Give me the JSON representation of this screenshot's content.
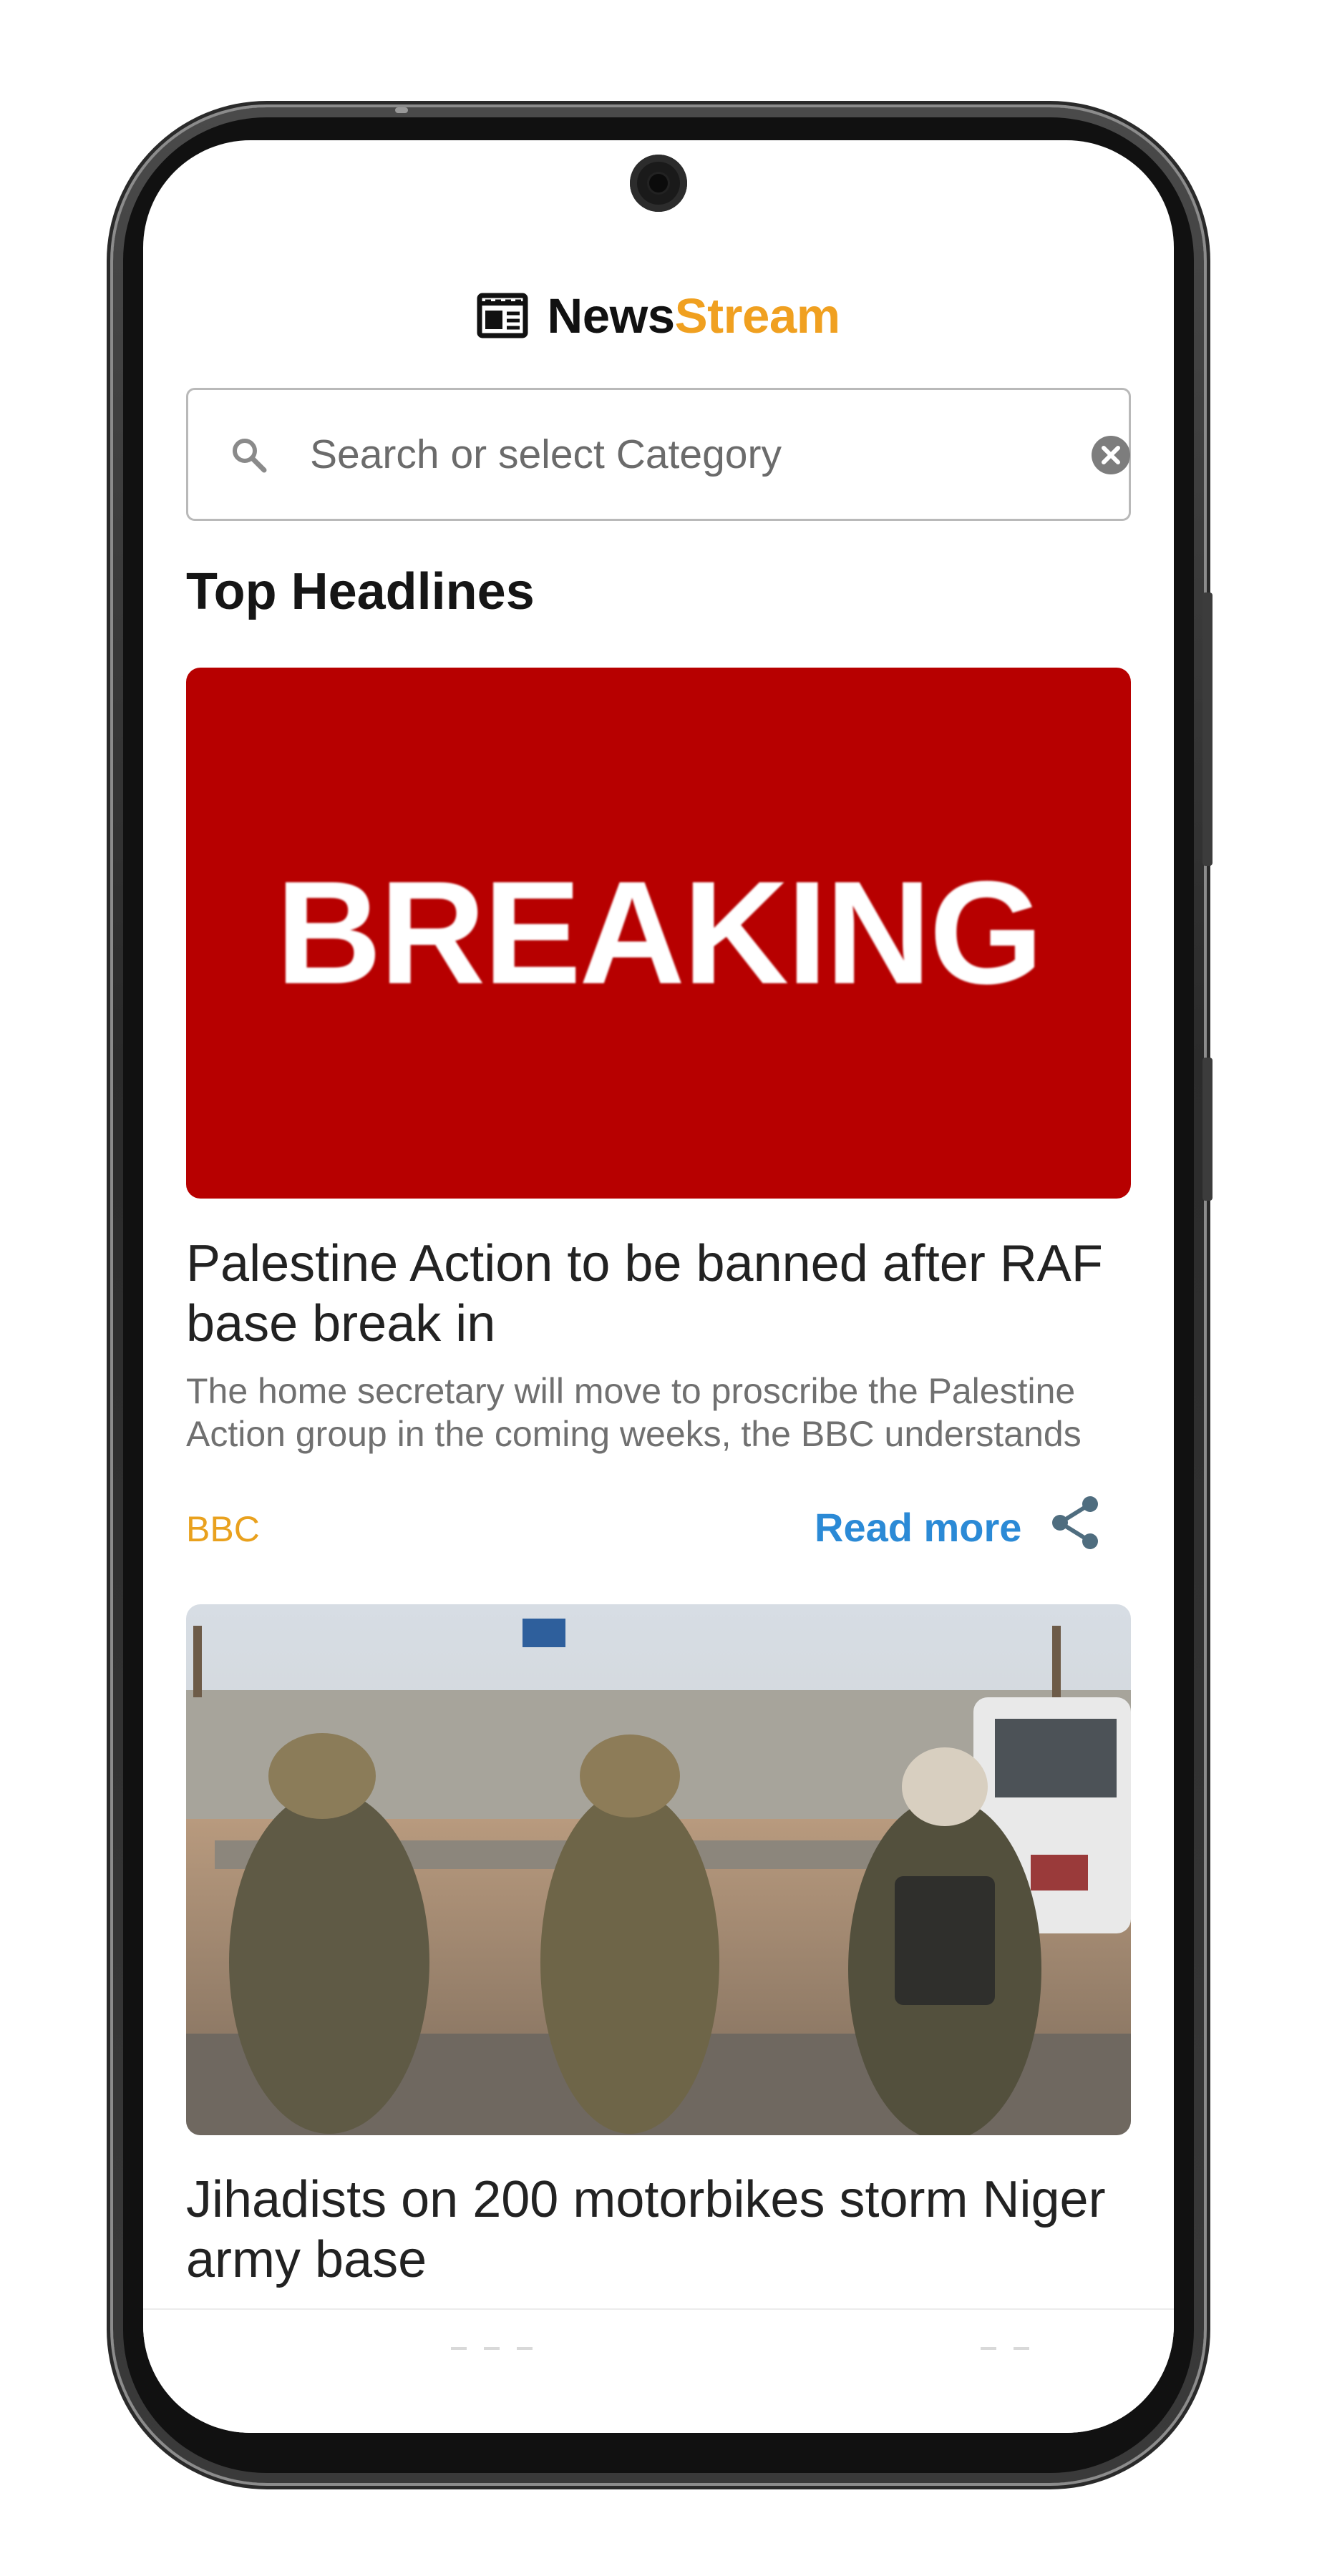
{
  "app": {
    "brand_part1": "News",
    "brand_part2": "Stream",
    "brand_color": "#f0a020",
    "logo_icon": "newspaper-icon"
  },
  "search": {
    "placeholder": "Search or select Category",
    "value": "",
    "icon": "search-icon",
    "clear_icon": "clear-icon"
  },
  "section": {
    "title": "Top Headlines"
  },
  "articles": [
    {
      "image_text": "BREAKING",
      "image_bg": "#b70000",
      "title": "Palestine Action to be banned after RAF base break in",
      "description": "The home secretary will move to proscribe the Palestine Action group in the coming weeks, the BBC understands",
      "source": "BBC",
      "read_more": "Read more",
      "share_icon": "share-icon"
    },
    {
      "title": "Jihadists on 200 motorbikes storm Niger army base"
    }
  ],
  "colors": {
    "source": "#e9a11e",
    "link": "#2b8ad6"
  }
}
